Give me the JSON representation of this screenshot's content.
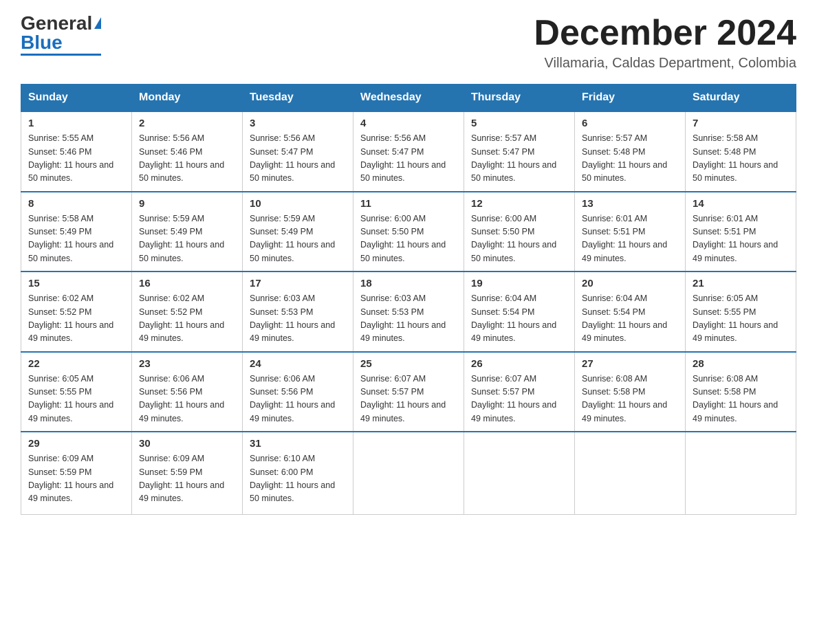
{
  "logo": {
    "general": "General",
    "blue": "Blue"
  },
  "title": "December 2024",
  "location": "Villamaria, Caldas Department, Colombia",
  "headers": [
    "Sunday",
    "Monday",
    "Tuesday",
    "Wednesday",
    "Thursday",
    "Friday",
    "Saturday"
  ],
  "weeks": [
    [
      {
        "day": "1",
        "sunrise": "5:55 AM",
        "sunset": "5:46 PM",
        "daylight": "11 hours and 50 minutes."
      },
      {
        "day": "2",
        "sunrise": "5:56 AM",
        "sunset": "5:46 PM",
        "daylight": "11 hours and 50 minutes."
      },
      {
        "day": "3",
        "sunrise": "5:56 AM",
        "sunset": "5:47 PM",
        "daylight": "11 hours and 50 minutes."
      },
      {
        "day": "4",
        "sunrise": "5:56 AM",
        "sunset": "5:47 PM",
        "daylight": "11 hours and 50 minutes."
      },
      {
        "day": "5",
        "sunrise": "5:57 AM",
        "sunset": "5:47 PM",
        "daylight": "11 hours and 50 minutes."
      },
      {
        "day": "6",
        "sunrise": "5:57 AM",
        "sunset": "5:48 PM",
        "daylight": "11 hours and 50 minutes."
      },
      {
        "day": "7",
        "sunrise": "5:58 AM",
        "sunset": "5:48 PM",
        "daylight": "11 hours and 50 minutes."
      }
    ],
    [
      {
        "day": "8",
        "sunrise": "5:58 AM",
        "sunset": "5:49 PM",
        "daylight": "11 hours and 50 minutes."
      },
      {
        "day": "9",
        "sunrise": "5:59 AM",
        "sunset": "5:49 PM",
        "daylight": "11 hours and 50 minutes."
      },
      {
        "day": "10",
        "sunrise": "5:59 AM",
        "sunset": "5:49 PM",
        "daylight": "11 hours and 50 minutes."
      },
      {
        "day": "11",
        "sunrise": "6:00 AM",
        "sunset": "5:50 PM",
        "daylight": "11 hours and 50 minutes."
      },
      {
        "day": "12",
        "sunrise": "6:00 AM",
        "sunset": "5:50 PM",
        "daylight": "11 hours and 50 minutes."
      },
      {
        "day": "13",
        "sunrise": "6:01 AM",
        "sunset": "5:51 PM",
        "daylight": "11 hours and 49 minutes."
      },
      {
        "day": "14",
        "sunrise": "6:01 AM",
        "sunset": "5:51 PM",
        "daylight": "11 hours and 49 minutes."
      }
    ],
    [
      {
        "day": "15",
        "sunrise": "6:02 AM",
        "sunset": "5:52 PM",
        "daylight": "11 hours and 49 minutes."
      },
      {
        "day": "16",
        "sunrise": "6:02 AM",
        "sunset": "5:52 PM",
        "daylight": "11 hours and 49 minutes."
      },
      {
        "day": "17",
        "sunrise": "6:03 AM",
        "sunset": "5:53 PM",
        "daylight": "11 hours and 49 minutes."
      },
      {
        "day": "18",
        "sunrise": "6:03 AM",
        "sunset": "5:53 PM",
        "daylight": "11 hours and 49 minutes."
      },
      {
        "day": "19",
        "sunrise": "6:04 AM",
        "sunset": "5:54 PM",
        "daylight": "11 hours and 49 minutes."
      },
      {
        "day": "20",
        "sunrise": "6:04 AM",
        "sunset": "5:54 PM",
        "daylight": "11 hours and 49 minutes."
      },
      {
        "day": "21",
        "sunrise": "6:05 AM",
        "sunset": "5:55 PM",
        "daylight": "11 hours and 49 minutes."
      }
    ],
    [
      {
        "day": "22",
        "sunrise": "6:05 AM",
        "sunset": "5:55 PM",
        "daylight": "11 hours and 49 minutes."
      },
      {
        "day": "23",
        "sunrise": "6:06 AM",
        "sunset": "5:56 PM",
        "daylight": "11 hours and 49 minutes."
      },
      {
        "day": "24",
        "sunrise": "6:06 AM",
        "sunset": "5:56 PM",
        "daylight": "11 hours and 49 minutes."
      },
      {
        "day": "25",
        "sunrise": "6:07 AM",
        "sunset": "5:57 PM",
        "daylight": "11 hours and 49 minutes."
      },
      {
        "day": "26",
        "sunrise": "6:07 AM",
        "sunset": "5:57 PM",
        "daylight": "11 hours and 49 minutes."
      },
      {
        "day": "27",
        "sunrise": "6:08 AM",
        "sunset": "5:58 PM",
        "daylight": "11 hours and 49 minutes."
      },
      {
        "day": "28",
        "sunrise": "6:08 AM",
        "sunset": "5:58 PM",
        "daylight": "11 hours and 49 minutes."
      }
    ],
    [
      {
        "day": "29",
        "sunrise": "6:09 AM",
        "sunset": "5:59 PM",
        "daylight": "11 hours and 49 minutes."
      },
      {
        "day": "30",
        "sunrise": "6:09 AM",
        "sunset": "5:59 PM",
        "daylight": "11 hours and 49 minutes."
      },
      {
        "day": "31",
        "sunrise": "6:10 AM",
        "sunset": "6:00 PM",
        "daylight": "11 hours and 50 minutes."
      },
      {
        "day": "",
        "sunrise": "",
        "sunset": "",
        "daylight": ""
      },
      {
        "day": "",
        "sunrise": "",
        "sunset": "",
        "daylight": ""
      },
      {
        "day": "",
        "sunrise": "",
        "sunset": "",
        "daylight": ""
      },
      {
        "day": "",
        "sunrise": "",
        "sunset": "",
        "daylight": ""
      }
    ]
  ]
}
